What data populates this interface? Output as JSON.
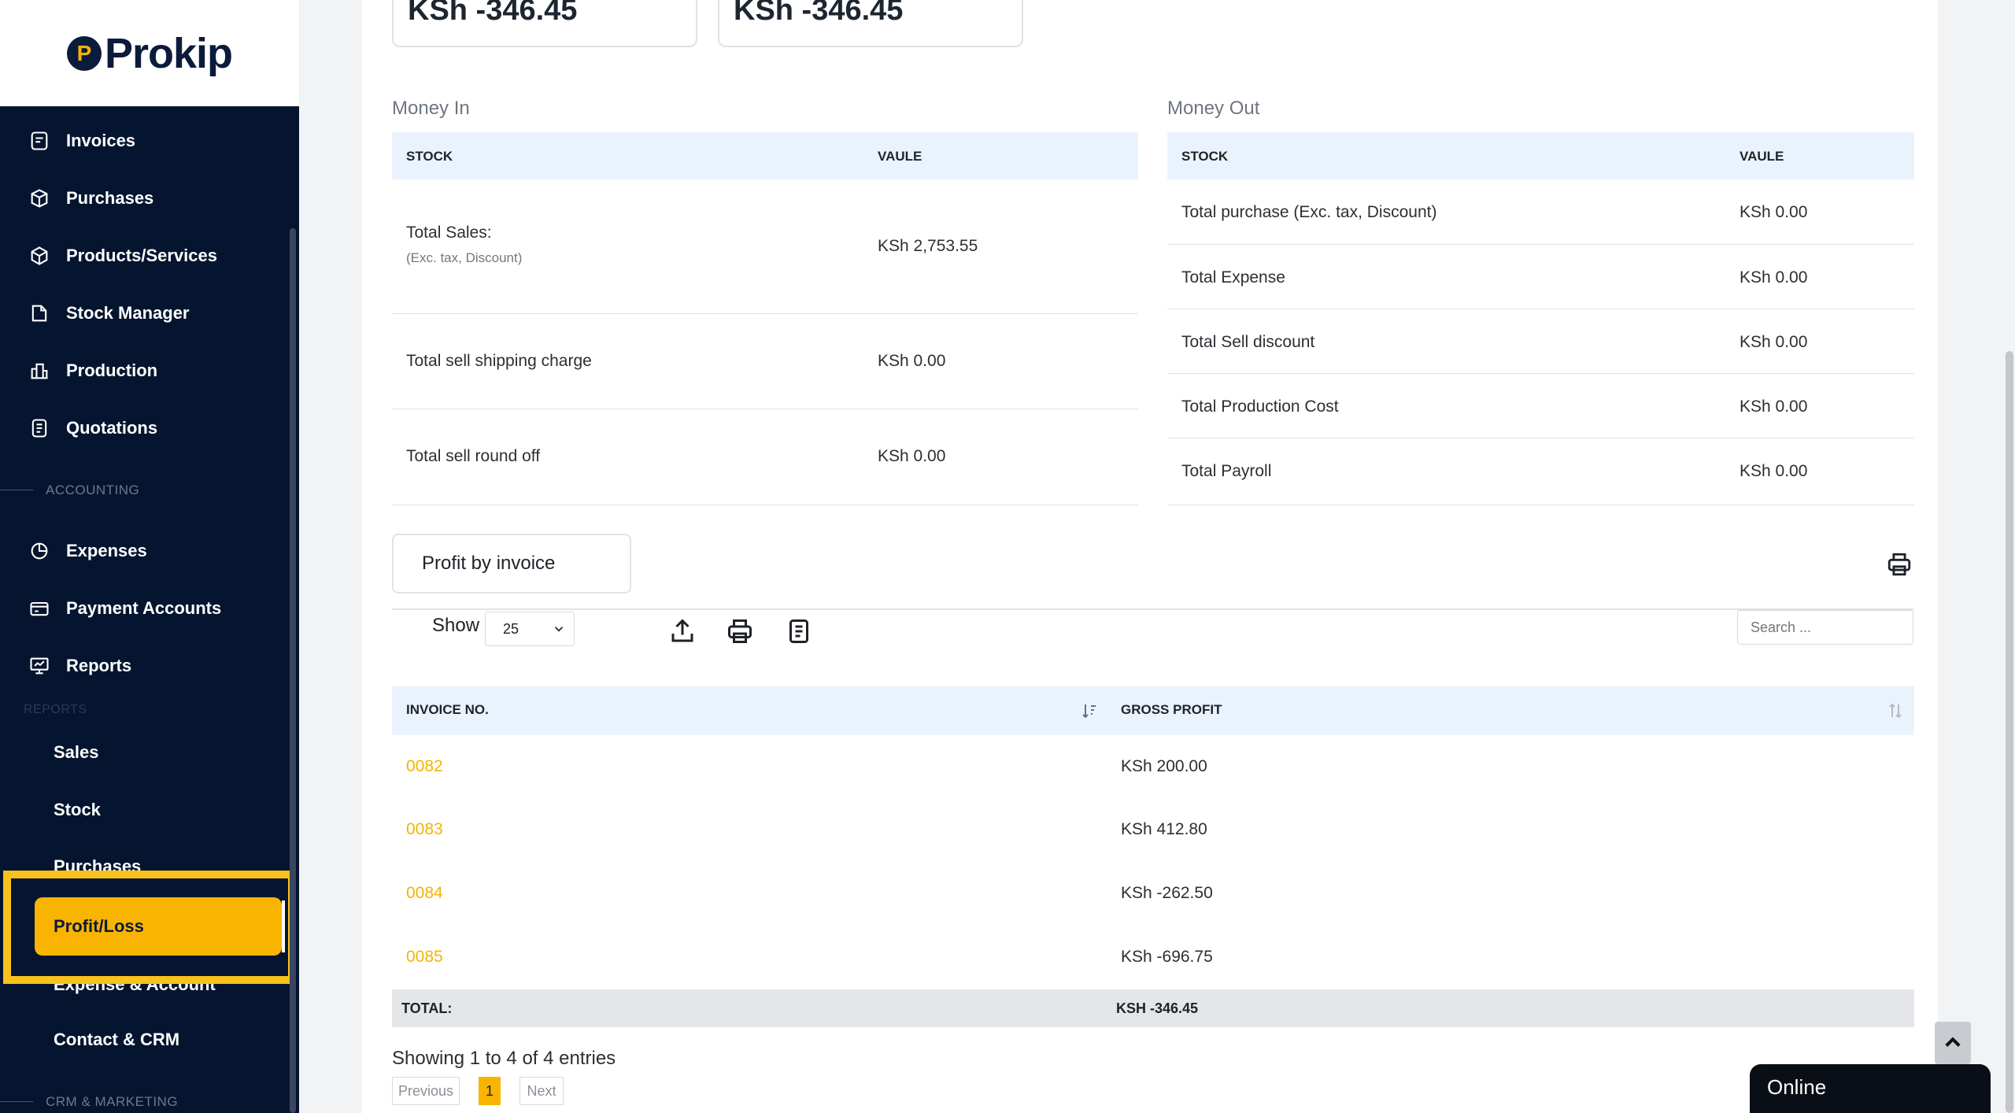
{
  "brand": {
    "name": "Prokip",
    "mark": "P"
  },
  "sidebar": {
    "items": [
      {
        "label": "Invoices",
        "icon": "invoice-icon"
      },
      {
        "label": "Purchases",
        "icon": "purchase-box-icon"
      },
      {
        "label": "Products/Services",
        "icon": "cube-icon"
      },
      {
        "label": "Stock Manager",
        "icon": "stock-icon"
      },
      {
        "label": "Production",
        "icon": "factory-icon"
      },
      {
        "label": "Quotations",
        "icon": "quote-icon"
      }
    ],
    "section_accounting": "ACCOUNTING",
    "accounting_items": [
      {
        "label": "Expenses",
        "icon": "pie-chart-icon"
      },
      {
        "label": "Payment Accounts",
        "icon": "card-icon"
      },
      {
        "label": "Reports",
        "icon": "presentation-icon"
      }
    ],
    "reports_sub_title": "REPORTS",
    "report_subitems": [
      "Sales",
      "Stock",
      "Purchases"
    ],
    "active_item": "Profit/Loss",
    "after_active": [
      "Expense & Account",
      "Contact & CRM"
    ],
    "section_crm": "CRM & MARKETING"
  },
  "kpis": [
    "KSh -346.45",
    "KSh -346.45"
  ],
  "money_in": {
    "title": "Money In",
    "col1": "STOCK",
    "col2": "VAULE",
    "rows": [
      {
        "label": "Total Sales:",
        "sub": "(Exc. tax, Discount)",
        "value": "KSh 2,753.55"
      },
      {
        "label": "Total sell shipping charge",
        "value": "KSh 0.00"
      },
      {
        "label": "Total sell round off",
        "value": "KSh 0.00"
      }
    ]
  },
  "money_out": {
    "title": "Money Out",
    "col1": "STOCK",
    "col2": "VAULE",
    "rows": [
      {
        "label": "Total purchase (Exc. tax, Discount)",
        "value": "KSh 0.00"
      },
      {
        "label": "Total Expense",
        "value": "KSh 0.00"
      },
      {
        "label": "Total Sell discount",
        "value": "KSh 0.00"
      },
      {
        "label": "Total Production Cost",
        "value": "KSh 0.00"
      },
      {
        "label": "Total Payroll",
        "value": "KSh 0.00"
      }
    ]
  },
  "profit_tab": "Profit by invoice",
  "table_controls": {
    "show_label": "Show",
    "page_size": "25",
    "search_placeholder": "Search ..."
  },
  "invoice_table": {
    "col1": "INVOICE NO.",
    "col2": "GROSS PROFIT",
    "rows": [
      {
        "no": "0082",
        "profit": "KSh 200.00"
      },
      {
        "no": "0083",
        "profit": "KSh 412.80"
      },
      {
        "no": "0084",
        "profit": "KSh -262.50"
      },
      {
        "no": "0085",
        "profit": "KSh -696.75"
      }
    ],
    "total_label": "TOTAL:",
    "total_value": "KSH -346.45"
  },
  "pagination": {
    "summary": "Showing 1 to 4 of 4 entries",
    "previous": "Previous",
    "current": "1",
    "next": "Next"
  },
  "chat": {
    "status": "Online"
  },
  "colors": {
    "sidebar": "#051530",
    "accent": "#f8b400",
    "header_row": "#eaf3fd"
  }
}
